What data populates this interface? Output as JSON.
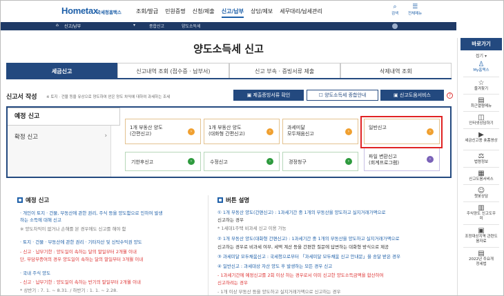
{
  "header": {
    "logo": "Hometax",
    "logo_sub": "국세청홈택스",
    "gnb": [
      "조회/발급",
      "민원증명",
      "신청/제출",
      "신고/납부",
      "상담/제보",
      "세무대리/납세관리"
    ],
    "active_gnb": "신고/납부",
    "tools": [
      {
        "label": "검색",
        "icon": "search-icon"
      },
      {
        "label": "전체메뉴",
        "icon": "menu-icon"
      }
    ]
  },
  "breadcrumb": {
    "home": "신고/납부",
    "items": [
      "종합신고",
      "양도소득세"
    ]
  },
  "page_title": "양도소득세 신고",
  "tabs": [
    "세금신고",
    "신고내역 조회 (접수증 · 납부서)",
    "신고 부속 · 증빙서류 제출",
    "삭제내역 조회"
  ],
  "report": {
    "heading": "신고서 작성",
    "desc": "※ 토지 · 건물 등을 유상으로 양도하여 얻은 양도 차익에 대하여 과세하는 조세",
    "buttons": [
      "제출증빙서류 확인",
      "양도소득세 종합안내",
      "신고도움서비스"
    ],
    "help": "?",
    "side": [
      "예정 신고",
      "확정 신고"
    ],
    "cards": [
      {
        "l1": "1개 부동산 양도",
        "l2": "(간편신고)",
        "go": "›"
      },
      {
        "l1": "1개 부동산 양도",
        "l2": "(대화형 간편신고)",
        "go": "›"
      },
      {
        "l1": "과세미달",
        "l2": "모두채움신고",
        "go": "›"
      },
      {
        "l1": "일반신고",
        "l2": "",
        "go": "›"
      },
      {
        "l1": "기한후신고",
        "l2": "",
        "go": "›"
      },
      {
        "l1": "수정신고",
        "l2": "",
        "go": "›"
      },
      {
        "l1": "경정청구",
        "l2": "",
        "go": "›"
      },
      {
        "l1": "파일 변환신고",
        "l2": "(회계프로그램)",
        "go": "›"
      }
    ]
  },
  "left_section": {
    "title": "예정 신고",
    "lines": [
      "· 개인이 토지 · 건물, 부동산에 관한 권리, 주식 등을 양도함으로 인하여 발생",
      "  하는 소득에 대해 신고",
      "  ※ 양도차익이 없거나 손해를 본 경우에도 신고를 해야 함",
      "· 토지 · 건물 · 부동산에 관한 권리 · 기타자산 및 신탁수익권 양도",
      "  - 신고 · 납부기한 : 양도일이 속하는 달의 말일부터 2개월 이내",
      "    단, 부담부증여의 경우 양도일이 속하는 달의 말일부터 3개월 이내",
      "· 국내 주식 양도",
      "  - 신고 · 납부기한 : 양도일이 속하는 반기의 말일부터 2개월 이내",
      "    * 상반기 : 7. 1. ~ 8.31. / 하반기 : 1. 1. ~ 2.28."
    ]
  },
  "right_section": {
    "title": "버튼 설명",
    "lines": [
      "① 1개 부동산 양도(간편신고) : 1과세기간 중 1개의 부동산을 양도하고 실지거래가액으로",
      "    신고하는 경우",
      "    * 1세대1주택 비과세 신고 이용 가능",
      "② 1개 부동산 양도(대화형 간편신고) : 1과세기간 중 1개의 부동산을 양도하고 실지거래가액으로",
      "    신고하는 경우로 비과세 여부, 세액 계산 등을 간편한 질문에 답변하는 대화형 방식으로 제공",
      "③ 과세미달 모두채움신고 : 국세청으로부터 「과세미달 모두채움 신고 안내문」을 송달 받은 경우",
      "④ 일반신고 : 과세대상 자산 양도 후 발생하는 모든 경우 신고",
      "    - 1과세기간에 예정신고를 2회 이상 하는 경우로서 이미 신고한 양도소득금액을 합산하여",
      "      신고하려는 경우",
      "    - 1개 이상 부동산 등을 양도하고 실지거래가액으로 신고하는 경우"
    ]
  },
  "quick_menu": {
    "title": "바로가기",
    "fold": "접기 ▾",
    "items": [
      {
        "label": "My홈택스",
        "icon": "person-icon",
        "on": true
      },
      {
        "label": "즐겨찾기",
        "icon": "star-icon"
      },
      {
        "label": "최근열람메뉴",
        "icon": "recent-icon"
      },
      {
        "label": "인터넷상담하기",
        "icon": "chat-icon"
      },
      {
        "label": "세금신고용 숏폼영상",
        "icon": "video-icon"
      },
      {
        "label": "법령정보",
        "icon": "law-icon"
      },
      {
        "label": "신고도움서비스",
        "icon": "help-service-icon"
      },
      {
        "label": "챗봇상담",
        "icon": "chatbot-icon"
      },
      {
        "label": "주식양도 신고도우미",
        "icon": "stock-icon"
      },
      {
        "label": "조정대상지역 관련도움자료",
        "icon": "region-icon"
      },
      {
        "label": "2022년 주요개정세법",
        "icon": "book-icon"
      }
    ]
  }
}
